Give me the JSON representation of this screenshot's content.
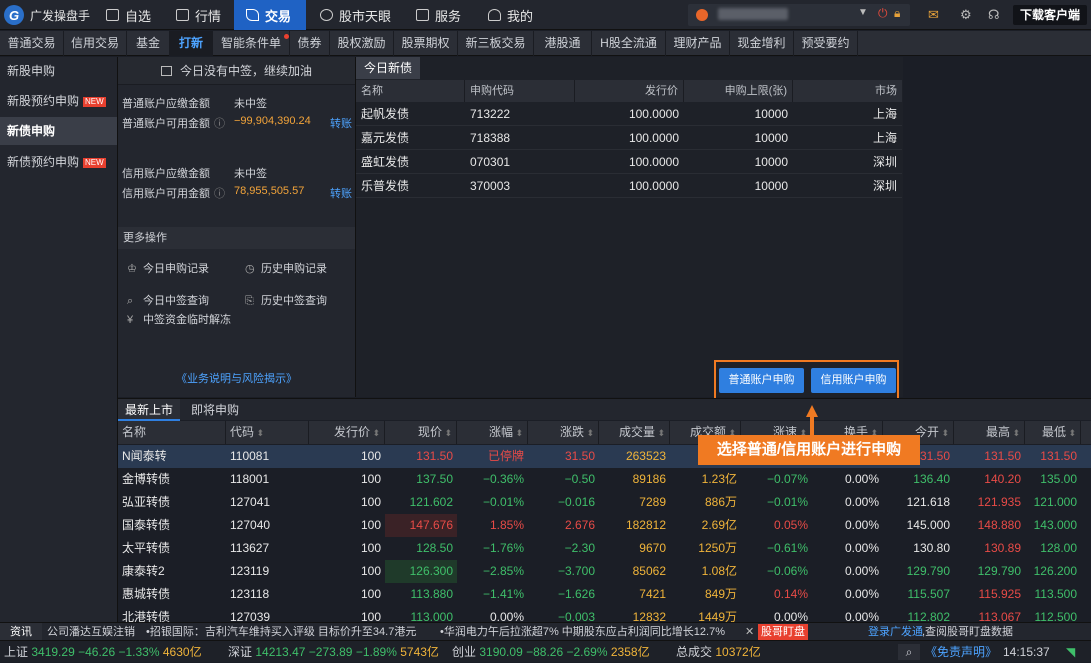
{
  "app": {
    "brand": "广发操盘手"
  },
  "topnav": [
    {
      "label": "自选",
      "icon": "plus-square-icon"
    },
    {
      "label": "行情",
      "icon": "chart-icon"
    },
    {
      "label": "交易",
      "icon": "trade-icon",
      "active": true
    },
    {
      "label": "股市天眼",
      "icon": "eye-icon"
    },
    {
      "label": "服务",
      "icon": "briefcase-icon"
    },
    {
      "label": "我的",
      "icon": "user-icon"
    }
  ],
  "download_label": "下载客户端",
  "subtabs": [
    "普通交易",
    "信用交易",
    "基金",
    "打新",
    "智能条件单",
    "债券",
    "股权激励",
    "股票期权",
    "新三板交易",
    "港股通",
    "H股全流通",
    "理财产品",
    "现金增利",
    "预受要约"
  ],
  "sidebar": [
    {
      "label": "新股申购",
      "new": false
    },
    {
      "label": "新股预约申购",
      "new": true
    },
    {
      "label": "新债申购",
      "new": false,
      "active": true
    },
    {
      "label": "新债预约申购",
      "new": true
    }
  ],
  "new_badge": "NEW",
  "mid": {
    "notice": "今日没有中签，继续加油",
    "normal_due_label": "普通账户应缴金额",
    "normal_due_value": "未中签",
    "normal_avail_label": "普通账户可用金额",
    "normal_avail_value": "−99,904,390.24",
    "credit_due_label": "信用账户应缴金额",
    "credit_due_value": "未中签",
    "credit_avail_label": "信用账户可用金额",
    "credit_avail_value": "78,955,505.57",
    "transfer": "转账",
    "more_ops": "更多操作",
    "op_today_apply": "今日申购记录",
    "op_hist_apply": "历史申购记录",
    "op_today_win": "今日中签查询",
    "op_hist_win": "历史中签查询",
    "op_unfreeze": "中签资金临时解冻",
    "biz_link": "《业务说明与风险揭示》"
  },
  "bonds": {
    "tab": "今日新债",
    "headers": [
      "名称",
      "申购代码",
      "发行价",
      "申购上限(张)",
      "市场"
    ],
    "rows": [
      [
        "起帆发债",
        "713222",
        "100.0000",
        "10000",
        "上海"
      ],
      [
        "嘉元发债",
        "718388",
        "100.0000",
        "10000",
        "上海"
      ],
      [
        "盛虹发债",
        "070301",
        "100.0000",
        "10000",
        "深圳"
      ],
      [
        "乐普发债",
        "370003",
        "100.0000",
        "10000",
        "深圳"
      ]
    ],
    "btn_normal": "普通账户申购",
    "btn_credit": "信用账户申购"
  },
  "annotation": "选择普通/信用账户进行申购",
  "lower": {
    "tabs": [
      "最新上市",
      "即将申购"
    ],
    "headers": [
      "名称",
      "代码",
      "发行价",
      "现价",
      "涨幅",
      "涨跌",
      "成交量",
      "成交额",
      "涨速",
      "换手",
      "今开",
      "最高",
      "最低"
    ],
    "rows": [
      {
        "cells": [
          "N闻泰转",
          "110081",
          "100",
          "131.50",
          "已停牌",
          "31.50",
          "263523",
          "",
          "",
          "",
          "131.50",
          "131.50",
          "131.50"
        ],
        "colors": [
          "w",
          "w",
          "w",
          "r",
          "r",
          "r",
          "y",
          "w",
          "w",
          "w",
          "r",
          "r",
          "r"
        ]
      },
      {
        "cells": [
          "金博转债",
          "118001",
          "100",
          "137.50",
          "−0.36%",
          "−0.50",
          "89186",
          "1.23亿",
          "−0.07%",
          "0.00%",
          "136.40",
          "140.20",
          "135.00"
        ],
        "colors": [
          "w",
          "w",
          "w",
          "g",
          "g",
          "g",
          "y",
          "y",
          "g",
          "w",
          "g",
          "r",
          "g"
        ]
      },
      {
        "cells": [
          "弘亚转债",
          "127041",
          "100",
          "121.602",
          "−0.01%",
          "−0.016",
          "7289",
          "886万",
          "−0.01%",
          "0.00%",
          "121.618",
          "121.935",
          "121.000"
        ],
        "colors": [
          "w",
          "w",
          "w",
          "g",
          "g",
          "g",
          "y",
          "y",
          "g",
          "w",
          "w",
          "r",
          "g"
        ]
      },
      {
        "cells": [
          "国泰转债",
          "127040",
          "100",
          "147.676",
          "1.85%",
          "2.676",
          "182812",
          "2.69亿",
          "0.05%",
          "0.00%",
          "145.000",
          "148.880",
          "143.000"
        ],
        "colors": [
          "w",
          "w",
          "w",
          "r",
          "r",
          "r",
          "y",
          "y",
          "r",
          "w",
          "w",
          "r",
          "g"
        ]
      },
      {
        "cells": [
          "太平转债",
          "113627",
          "100",
          "128.50",
          "−1.76%",
          "−2.30",
          "9670",
          "1250万",
          "−0.61%",
          "0.00%",
          "130.80",
          "130.89",
          "128.00"
        ],
        "colors": [
          "w",
          "w",
          "w",
          "g",
          "g",
          "g",
          "y",
          "y",
          "g",
          "w",
          "w",
          "r",
          "g"
        ]
      },
      {
        "cells": [
          "康泰转2",
          "123119",
          "100",
          "126.300",
          "−2.85%",
          "−3.700",
          "85062",
          "1.08亿",
          "−0.06%",
          "0.00%",
          "129.790",
          "129.790",
          "126.200"
        ],
        "colors": [
          "w",
          "w",
          "w",
          "g",
          "g",
          "g",
          "y",
          "y",
          "g",
          "w",
          "g",
          "g",
          "g"
        ]
      },
      {
        "cells": [
          "惠城转债",
          "123118",
          "100",
          "113.880",
          "−1.41%",
          "−1.626",
          "7421",
          "849万",
          "0.14%",
          "0.00%",
          "115.507",
          "115.925",
          "113.500"
        ],
        "colors": [
          "w",
          "w",
          "w",
          "g",
          "g",
          "g",
          "y",
          "y",
          "r",
          "w",
          "g",
          "r",
          "g"
        ]
      },
      {
        "cells": [
          "北港转债",
          "127039",
          "100",
          "113.000",
          "0.00%",
          "−0.003",
          "12832",
          "1449万",
          "0.00%",
          "0.00%",
          "112.802",
          "113.067",
          "112.500"
        ],
        "colors": [
          "w",
          "w",
          "w",
          "g",
          "w",
          "g",
          "y",
          "y",
          "w",
          "w",
          "g",
          "r",
          "g"
        ]
      }
    ]
  },
  "news": {
    "label": "资讯",
    "items": [
      "公司潘达互娱注销",
      "•招银国际：吉利汽车维持买入评级 目标价升至34.7港元",
      "•华润电力午后拉涨超7% 中期股东应占利润同比增长12.7%"
    ],
    "hot": "股哥盯盘",
    "login_link": "登录广发通",
    "login_text": ",查阅股哥盯盘数据"
  },
  "status": {
    "sh_label": "上证",
    "sh_val": "3419.29",
    "sh_chg": "−46.26",
    "sh_pct": "−1.33%",
    "sh_amt": "4630亿",
    "sz_label": "深证",
    "sz_val": "14213.47",
    "sz_chg": "−273.89",
    "sz_pct": "−1.89%",
    "sz_amt": "5743亿",
    "cy_label": "创业",
    "cy_val": "3190.09",
    "cy_chg": "−88.26",
    "cy_pct": "−2.69%",
    "cy_amt": "2358亿",
    "total_label": "总成交",
    "total_val": "10372亿",
    "disclaimer": "《免责声明》",
    "time": "14:15:37"
  },
  "colors": {
    "accent": "#1f62c4",
    "up": "#e84b47",
    "down": "#3fbf6a",
    "highlight": "#f07a22"
  }
}
